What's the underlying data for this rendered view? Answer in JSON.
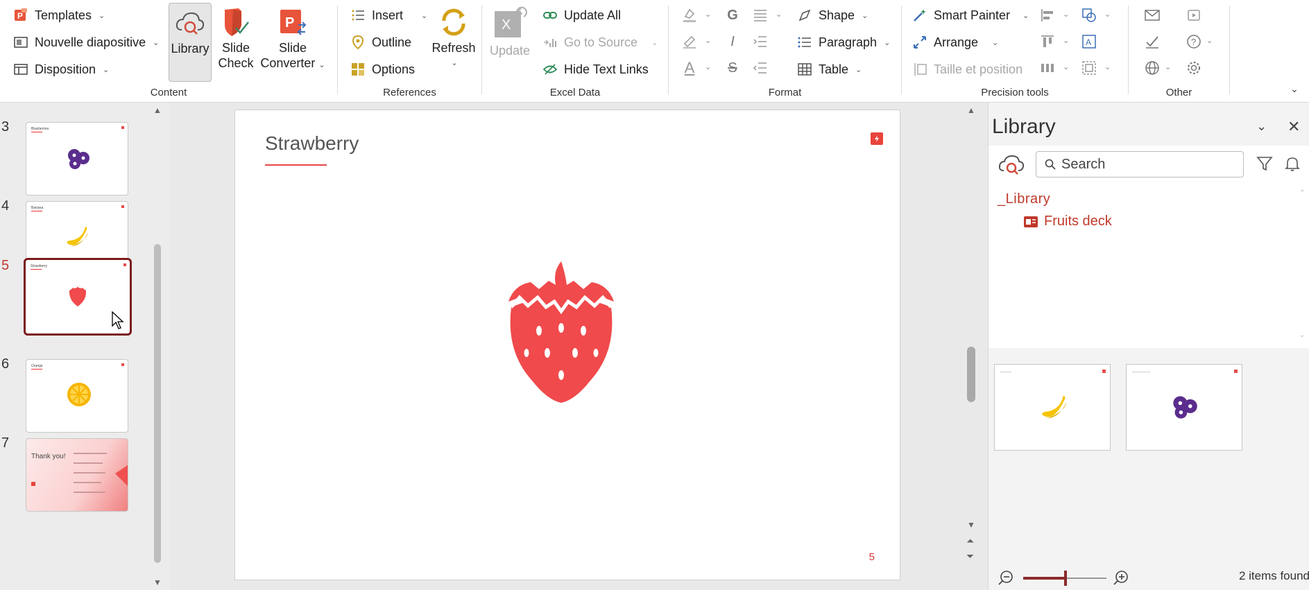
{
  "ribbon": {
    "content": {
      "templates": "Templates",
      "new_slide": "Nouvelle diapositive",
      "layout": "Disposition",
      "library": "Library",
      "slide_check_1": "Slide",
      "slide_check_2": "Check",
      "slide_converter_1": "Slide",
      "slide_converter_2": "Converter",
      "group_label": "Content"
    },
    "references": {
      "insert": "Insert",
      "outline": "Outline",
      "options": "Options",
      "refresh": "Refresh",
      "group_label": "References"
    },
    "excel": {
      "update": "Update",
      "update_all": "Update All",
      "go_to_source": "Go to Source",
      "hide_text_links": "Hide Text Links",
      "group_label": "Excel Data"
    },
    "format": {
      "bold": "G",
      "italic": "I",
      "strike": "S",
      "font_color": "A",
      "shape": "Shape",
      "paragraph": "Paragraph",
      "table": "Table",
      "group_label": "Format"
    },
    "precision": {
      "smart_painter": "Smart Painter",
      "arrange": "Arrange",
      "size_position": "Taille et position",
      "group_label": "Precision tools"
    },
    "other": {
      "group_label": "Other"
    }
  },
  "thumbnails": [
    {
      "number": "3",
      "title": "Blueberries",
      "icon": "blueberry-icon"
    },
    {
      "number": "4",
      "title": "Banana",
      "icon": "banana-icon"
    },
    {
      "number": "5",
      "title": "Strawberry",
      "icon": "strawberry-icon",
      "active": true
    },
    {
      "number": "6",
      "title": "Orange",
      "icon": "orange-icon"
    },
    {
      "number": "7",
      "title": "Thank you!",
      "icon": "closing-slide"
    }
  ],
  "slide": {
    "title": "Strawberry",
    "number": "5"
  },
  "library": {
    "title": "Library",
    "search_placeholder": "Search",
    "root": "_Library",
    "folder": "Fruits deck",
    "items_found": "2 items found"
  },
  "colors": {
    "accent": "#c0392b",
    "strawberry": "#f04a4c",
    "banana": "#f5c400",
    "blueberry": "#5b2d8e",
    "orange": "#f7b500"
  }
}
